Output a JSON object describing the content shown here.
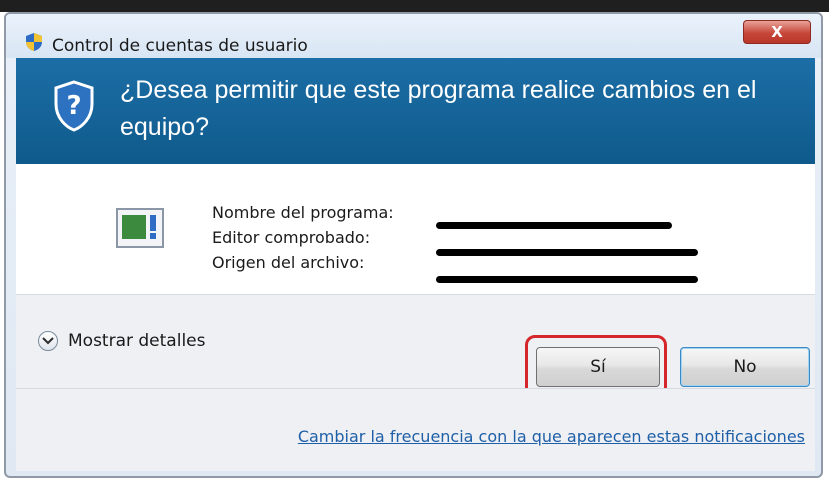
{
  "window": {
    "title": "Control de cuentas de usuario",
    "close_label": "X"
  },
  "header": {
    "question": "¿Desea permitir que este programa realice cambios en el equipo?"
  },
  "program_info": {
    "name_label": "Nombre del programa:",
    "publisher_label": "Editor comprobado:",
    "origin_label": "Origen del archivo:"
  },
  "actions": {
    "details_label": "Mostrar detalles",
    "yes_label": "Sí",
    "no_label": "No"
  },
  "footer": {
    "link": "Cambiar la frecuencia con la que aparecen estas notificaciones"
  }
}
